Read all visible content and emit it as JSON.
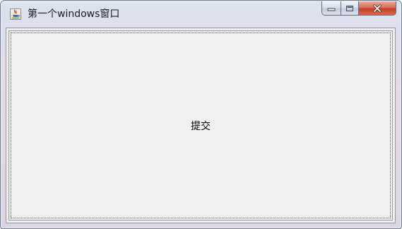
{
  "window": {
    "title": "第一个windows窗口",
    "icon": "java-cup-icon",
    "caption_buttons": {
      "minimize_icon": "minimize-icon",
      "maximize_icon": "maximize-icon",
      "close_icon": "close-icon"
    }
  },
  "content": {
    "submit_label": "提交"
  },
  "colors": {
    "close_button": "#c8432a",
    "client_background": "#f0f0f0"
  }
}
